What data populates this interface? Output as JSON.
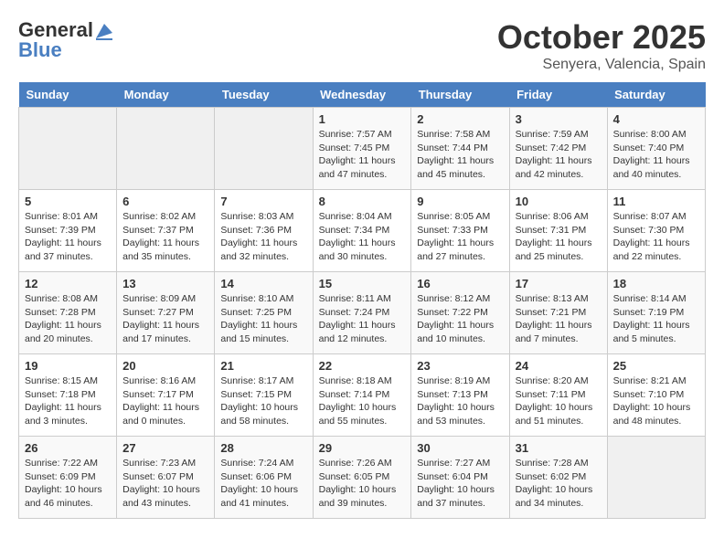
{
  "header": {
    "logo_general": "General",
    "logo_blue": "Blue",
    "month": "October 2025",
    "location": "Senyera, Valencia, Spain"
  },
  "weekdays": [
    "Sunday",
    "Monday",
    "Tuesday",
    "Wednesday",
    "Thursday",
    "Friday",
    "Saturday"
  ],
  "weeks": [
    [
      {
        "day": "",
        "sunrise": "",
        "sunset": "",
        "daylight": ""
      },
      {
        "day": "",
        "sunrise": "",
        "sunset": "",
        "daylight": ""
      },
      {
        "day": "",
        "sunrise": "",
        "sunset": "",
        "daylight": ""
      },
      {
        "day": "1",
        "sunrise": "Sunrise: 7:57 AM",
        "sunset": "Sunset: 7:45 PM",
        "daylight": "Daylight: 11 hours and 47 minutes."
      },
      {
        "day": "2",
        "sunrise": "Sunrise: 7:58 AM",
        "sunset": "Sunset: 7:44 PM",
        "daylight": "Daylight: 11 hours and 45 minutes."
      },
      {
        "day": "3",
        "sunrise": "Sunrise: 7:59 AM",
        "sunset": "Sunset: 7:42 PM",
        "daylight": "Daylight: 11 hours and 42 minutes."
      },
      {
        "day": "4",
        "sunrise": "Sunrise: 8:00 AM",
        "sunset": "Sunset: 7:40 PM",
        "daylight": "Daylight: 11 hours and 40 minutes."
      }
    ],
    [
      {
        "day": "5",
        "sunrise": "Sunrise: 8:01 AM",
        "sunset": "Sunset: 7:39 PM",
        "daylight": "Daylight: 11 hours and 37 minutes."
      },
      {
        "day": "6",
        "sunrise": "Sunrise: 8:02 AM",
        "sunset": "Sunset: 7:37 PM",
        "daylight": "Daylight: 11 hours and 35 minutes."
      },
      {
        "day": "7",
        "sunrise": "Sunrise: 8:03 AM",
        "sunset": "Sunset: 7:36 PM",
        "daylight": "Daylight: 11 hours and 32 minutes."
      },
      {
        "day": "8",
        "sunrise": "Sunrise: 8:04 AM",
        "sunset": "Sunset: 7:34 PM",
        "daylight": "Daylight: 11 hours and 30 minutes."
      },
      {
        "day": "9",
        "sunrise": "Sunrise: 8:05 AM",
        "sunset": "Sunset: 7:33 PM",
        "daylight": "Daylight: 11 hours and 27 minutes."
      },
      {
        "day": "10",
        "sunrise": "Sunrise: 8:06 AM",
        "sunset": "Sunset: 7:31 PM",
        "daylight": "Daylight: 11 hours and 25 minutes."
      },
      {
        "day": "11",
        "sunrise": "Sunrise: 8:07 AM",
        "sunset": "Sunset: 7:30 PM",
        "daylight": "Daylight: 11 hours and 22 minutes."
      }
    ],
    [
      {
        "day": "12",
        "sunrise": "Sunrise: 8:08 AM",
        "sunset": "Sunset: 7:28 PM",
        "daylight": "Daylight: 11 hours and 20 minutes."
      },
      {
        "day": "13",
        "sunrise": "Sunrise: 8:09 AM",
        "sunset": "Sunset: 7:27 PM",
        "daylight": "Daylight: 11 hours and 17 minutes."
      },
      {
        "day": "14",
        "sunrise": "Sunrise: 8:10 AM",
        "sunset": "Sunset: 7:25 PM",
        "daylight": "Daylight: 11 hours and 15 minutes."
      },
      {
        "day": "15",
        "sunrise": "Sunrise: 8:11 AM",
        "sunset": "Sunset: 7:24 PM",
        "daylight": "Daylight: 11 hours and 12 minutes."
      },
      {
        "day": "16",
        "sunrise": "Sunrise: 8:12 AM",
        "sunset": "Sunset: 7:22 PM",
        "daylight": "Daylight: 11 hours and 10 minutes."
      },
      {
        "day": "17",
        "sunrise": "Sunrise: 8:13 AM",
        "sunset": "Sunset: 7:21 PM",
        "daylight": "Daylight: 11 hours and 7 minutes."
      },
      {
        "day": "18",
        "sunrise": "Sunrise: 8:14 AM",
        "sunset": "Sunset: 7:19 PM",
        "daylight": "Daylight: 11 hours and 5 minutes."
      }
    ],
    [
      {
        "day": "19",
        "sunrise": "Sunrise: 8:15 AM",
        "sunset": "Sunset: 7:18 PM",
        "daylight": "Daylight: 11 hours and 3 minutes."
      },
      {
        "day": "20",
        "sunrise": "Sunrise: 8:16 AM",
        "sunset": "Sunset: 7:17 PM",
        "daylight": "Daylight: 11 hours and 0 minutes."
      },
      {
        "day": "21",
        "sunrise": "Sunrise: 8:17 AM",
        "sunset": "Sunset: 7:15 PM",
        "daylight": "Daylight: 10 hours and 58 minutes."
      },
      {
        "day": "22",
        "sunrise": "Sunrise: 8:18 AM",
        "sunset": "Sunset: 7:14 PM",
        "daylight": "Daylight: 10 hours and 55 minutes."
      },
      {
        "day": "23",
        "sunrise": "Sunrise: 8:19 AM",
        "sunset": "Sunset: 7:13 PM",
        "daylight": "Daylight: 10 hours and 53 minutes."
      },
      {
        "day": "24",
        "sunrise": "Sunrise: 8:20 AM",
        "sunset": "Sunset: 7:11 PM",
        "daylight": "Daylight: 10 hours and 51 minutes."
      },
      {
        "day": "25",
        "sunrise": "Sunrise: 8:21 AM",
        "sunset": "Sunset: 7:10 PM",
        "daylight": "Daylight: 10 hours and 48 minutes."
      }
    ],
    [
      {
        "day": "26",
        "sunrise": "Sunrise: 7:22 AM",
        "sunset": "Sunset: 6:09 PM",
        "daylight": "Daylight: 10 hours and 46 minutes."
      },
      {
        "day": "27",
        "sunrise": "Sunrise: 7:23 AM",
        "sunset": "Sunset: 6:07 PM",
        "daylight": "Daylight: 10 hours and 43 minutes."
      },
      {
        "day": "28",
        "sunrise": "Sunrise: 7:24 AM",
        "sunset": "Sunset: 6:06 PM",
        "daylight": "Daylight: 10 hours and 41 minutes."
      },
      {
        "day": "29",
        "sunrise": "Sunrise: 7:26 AM",
        "sunset": "Sunset: 6:05 PM",
        "daylight": "Daylight: 10 hours and 39 minutes."
      },
      {
        "day": "30",
        "sunrise": "Sunrise: 7:27 AM",
        "sunset": "Sunset: 6:04 PM",
        "daylight": "Daylight: 10 hours and 37 minutes."
      },
      {
        "day": "31",
        "sunrise": "Sunrise: 7:28 AM",
        "sunset": "Sunset: 6:02 PM",
        "daylight": "Daylight: 10 hours and 34 minutes."
      },
      {
        "day": "",
        "sunrise": "",
        "sunset": "",
        "daylight": ""
      }
    ]
  ]
}
